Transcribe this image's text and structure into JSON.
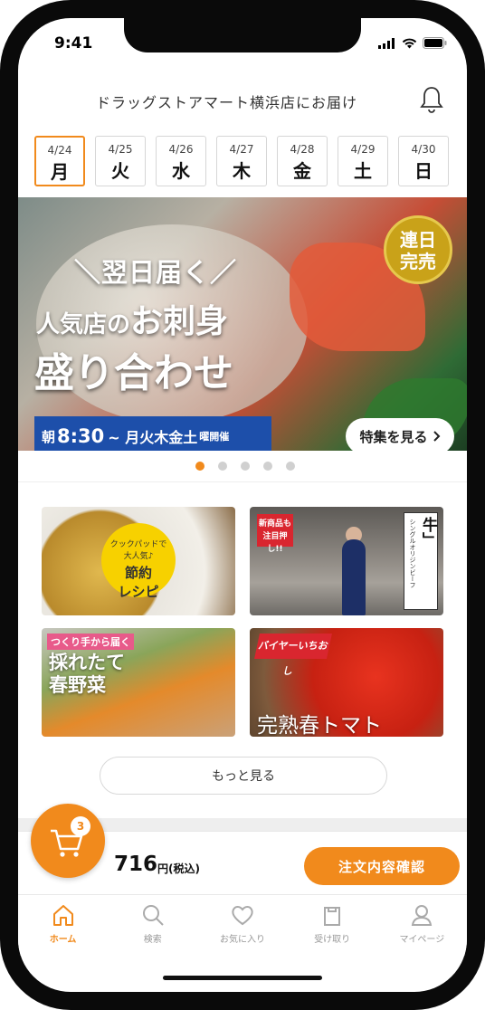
{
  "status": {
    "time": "9:41"
  },
  "header": {
    "title": "ドラッグストアマート横浜店にお届け"
  },
  "dates": [
    {
      "date": "4/24",
      "weekday": "月",
      "selected": true
    },
    {
      "date": "4/25",
      "weekday": "火",
      "selected": false
    },
    {
      "date": "4/26",
      "weekday": "水",
      "selected": false
    },
    {
      "date": "4/27",
      "weekday": "木",
      "selected": false
    },
    {
      "date": "4/28",
      "weekday": "金",
      "selected": false
    },
    {
      "date": "4/29",
      "weekday": "土",
      "selected": false
    },
    {
      "date": "4/30",
      "weekday": "日",
      "selected": false
    }
  ],
  "banner": {
    "line1": "＼翌日届く／",
    "line2_prefix": "人気店の",
    "line2_main": "お刺身",
    "line3": "盛り合わせ",
    "badge_line1": "連日",
    "badge_line2": "完売",
    "strip_prefix": "朝",
    "strip_time": "8:30",
    "strip_days": "~ 月火木金土",
    "strip_suffix": "曜開催",
    "feature_button": "特集を見る"
  },
  "carousel": {
    "count": 5,
    "active_index": 0
  },
  "tiles": {
    "recipe": {
      "seal_line1": "クックパッドで",
      "seal_line2": "大人気♪",
      "seal_line3": "節約",
      "seal_line4": "レシピ"
    },
    "beef": {
      "new_label": "新商品も注目押し!!",
      "small_text": "シングルオリジンビーフ",
      "title": "「葉山石井牛」"
    },
    "vegetables": {
      "pink_label": "つくり手から届く",
      "line1": "採れたて",
      "line2": "春野菜"
    },
    "tomato": {
      "tag": "バイヤーいちおし",
      "label": "完熟春トマト"
    }
  },
  "more_button": "もっと見る",
  "cart": {
    "count": "3",
    "total": "716",
    "unit": "円(税込)",
    "confirm_button": "注文内容確認"
  },
  "tabs": [
    {
      "label": "ホーム",
      "icon": "home-icon",
      "active": true
    },
    {
      "label": "検索",
      "icon": "search-icon",
      "active": false
    },
    {
      "label": "お気に入り",
      "icon": "heart-icon",
      "active": false
    },
    {
      "label": "受け取り",
      "icon": "bag-icon",
      "active": false
    },
    {
      "label": "マイページ",
      "icon": "user-icon",
      "active": false
    }
  ],
  "colors": {
    "accent": "#f18a1c",
    "banner_strip": "#1d4faa",
    "badge": "#c9a219",
    "tag_red": "#d9262f"
  }
}
